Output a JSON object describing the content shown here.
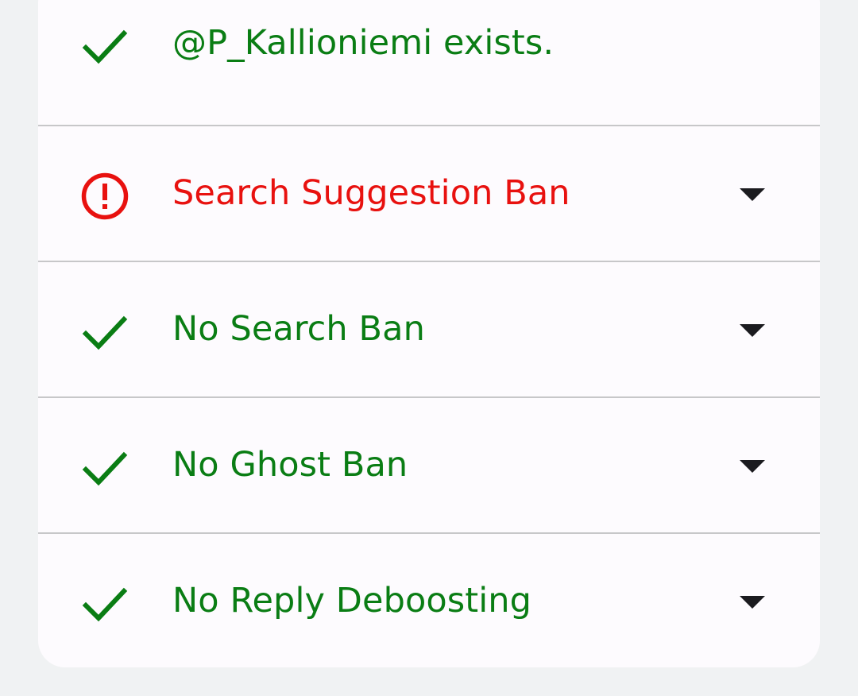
{
  "colors": {
    "ok": "#0a7d14",
    "warning": "#e8110f",
    "background": "#f0f2f3",
    "card": "#fdfbfe",
    "divider": "#c7c7c9",
    "caret": "#1b1b1f"
  },
  "results": [
    {
      "status": "ok",
      "icon": "checkmark-icon",
      "label": "@P_Kallioniemi exists.",
      "expandable": false
    },
    {
      "status": "warning",
      "icon": "alert-circle-icon",
      "label": "Search Suggestion Ban",
      "expandable": true
    },
    {
      "status": "ok",
      "icon": "checkmark-icon",
      "label": "No Search Ban",
      "expandable": true
    },
    {
      "status": "ok",
      "icon": "checkmark-icon",
      "label": "No Ghost Ban",
      "expandable": true
    },
    {
      "status": "ok",
      "icon": "checkmark-icon",
      "label": "No Reply Deboosting",
      "expandable": true
    }
  ]
}
